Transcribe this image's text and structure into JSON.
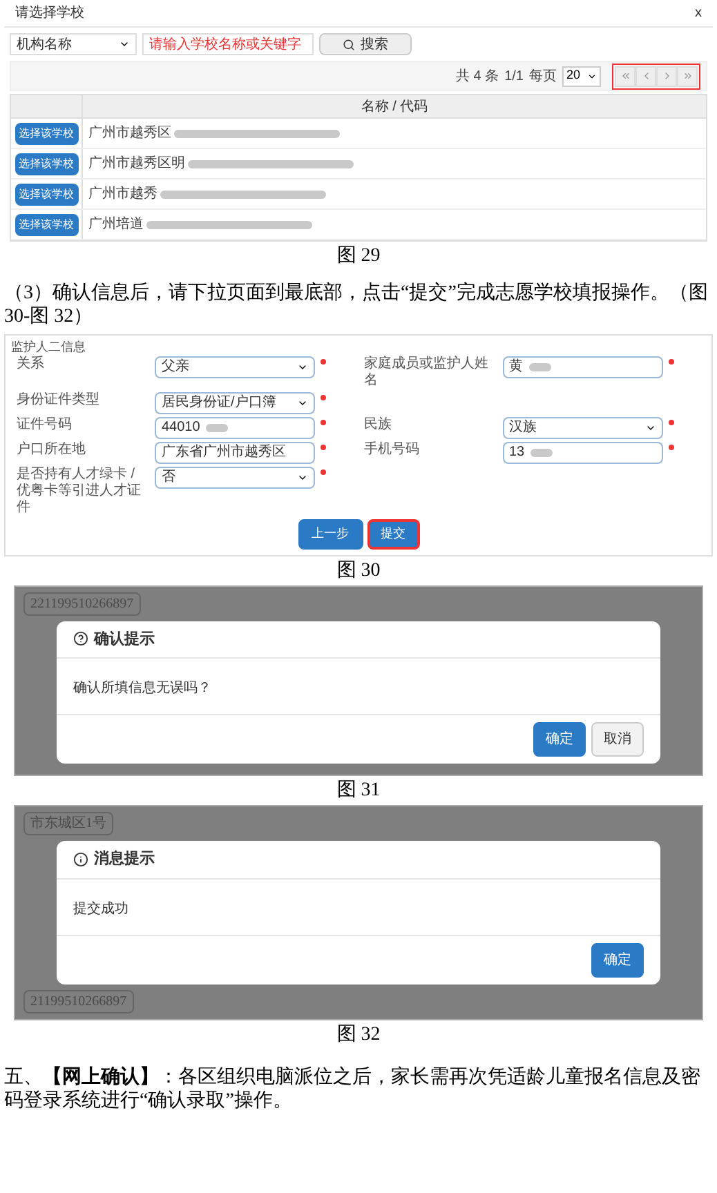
{
  "fig29": {
    "dialog_title": "请选择学校",
    "close": "x",
    "filter_select": "机构名称",
    "search_placeholder": "请输入学校名称或关键字",
    "search_button": "搜索",
    "total": "共 4 条",
    "page": "1/1",
    "per_page_label": "每页",
    "per_page": "20",
    "column": "名称 / 代码",
    "rows": [
      {
        "button": "选择该学校",
        "name": "广州市越秀区",
        "redacted": true
      },
      {
        "button": "选择该学校",
        "name": "广州市越秀区明",
        "redacted": true
      },
      {
        "button": "选择该学校",
        "name": "广州市越秀",
        "redacted": true
      },
      {
        "button": "选择该学校",
        "name": "广州培道",
        "redacted": true
      }
    ],
    "caption": "图 29"
  },
  "step_text": "（3）确认信息后，请下拉页面到最底部，点击“提交”完成志愿学校填报操作。（图 30-图 32）",
  "fig30": {
    "legend": "监护人二信息",
    "rows": [
      [
        {
          "label": "关系",
          "kind": "select",
          "value": "父亲",
          "redacted": false
        },
        {
          "label": "家庭成员或监护人姓名",
          "kind": "input",
          "value": "黄",
          "redacted": true
        }
      ],
      [
        {
          "label": "身份证件类型",
          "kind": "select",
          "value": "居民身份证/户口簿",
          "redacted": false
        }
      ],
      [
        {
          "label": "证件号码",
          "kind": "input",
          "value": "44010",
          "redacted": true
        },
        {
          "label": "民族",
          "kind": "select",
          "value": "汉族",
          "redacted": false
        }
      ],
      [
        {
          "label": "户口所在地",
          "kind": "input",
          "value": "广东省广州市越秀区",
          "redacted": false
        },
        {
          "label": "手机号码",
          "kind": "input",
          "value": "13",
          "redacted": true
        }
      ],
      [
        {
          "label": "是否持有人才绿卡 / 优粤卡等引进人才证件",
          "kind": "select",
          "value": "否",
          "redacted": false
        }
      ]
    ],
    "buttons": [
      {
        "label": "上一步",
        "highlighted": false
      },
      {
        "label": "提交",
        "highlighted": true
      }
    ],
    "caption": "图 30"
  },
  "fig31": {
    "background_texts": [
      "221199510266897"
    ],
    "title": "确认提示",
    "message": "确认所填信息无误吗？",
    "buttons": [
      {
        "label": "确定",
        "kind": "primary"
      },
      {
        "label": "取消",
        "kind": "default"
      }
    ],
    "caption": "图 31"
  },
  "fig32": {
    "background_texts": [
      "市东城区1号",
      "21199510266897"
    ],
    "title": "消息提示",
    "message": "提交成功",
    "buttons": [
      {
        "label": "确定",
        "kind": "primary"
      }
    ],
    "caption": "图 32"
  },
  "section_text": "五、**【网上确认】**：各区组织电脑派位之后，家长需再次凭适龄儿童报名信息及密码登录系统进行“确认录取”操作。"
}
